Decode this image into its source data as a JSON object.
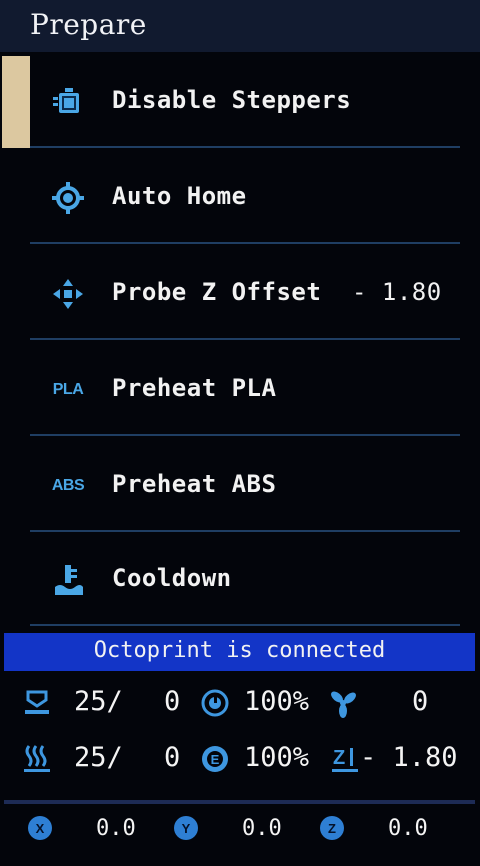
{
  "title": "Prepare",
  "menu": {
    "items": [
      {
        "label": "Disable Steppers",
        "icon": "steppers-icon",
        "value": ""
      },
      {
        "label": "Auto Home",
        "icon": "home-target-icon",
        "value": ""
      },
      {
        "label": "Probe Z Offset",
        "icon": "z-offset-icon",
        "value": "- 1.80"
      },
      {
        "label": "Preheat PLA",
        "icon": "PLA",
        "value": ""
      },
      {
        "label": "Preheat ABS",
        "icon": "ABS",
        "value": ""
      },
      {
        "label": "Cooldown",
        "icon": "cooldown-icon",
        "value": ""
      }
    ],
    "selected_index": 0
  },
  "status_message": "Octoprint is connected",
  "info": {
    "bed_temp": "25/",
    "bed_target": "0",
    "speed": "100%",
    "fan": "0",
    "hotend_temp": "25/",
    "hotend_target": "0",
    "flow": "100%",
    "z_offset": "- 1.80"
  },
  "axes": {
    "x_label": "X",
    "x_value": "0.0",
    "y_label": "Y",
    "y_value": "0.0",
    "z_label": "Z",
    "z_value": "0.0"
  },
  "colors": {
    "accent_blue": "#4aa7e6",
    "status_bar": "#1335c7",
    "selection": "#dcc8a0"
  }
}
